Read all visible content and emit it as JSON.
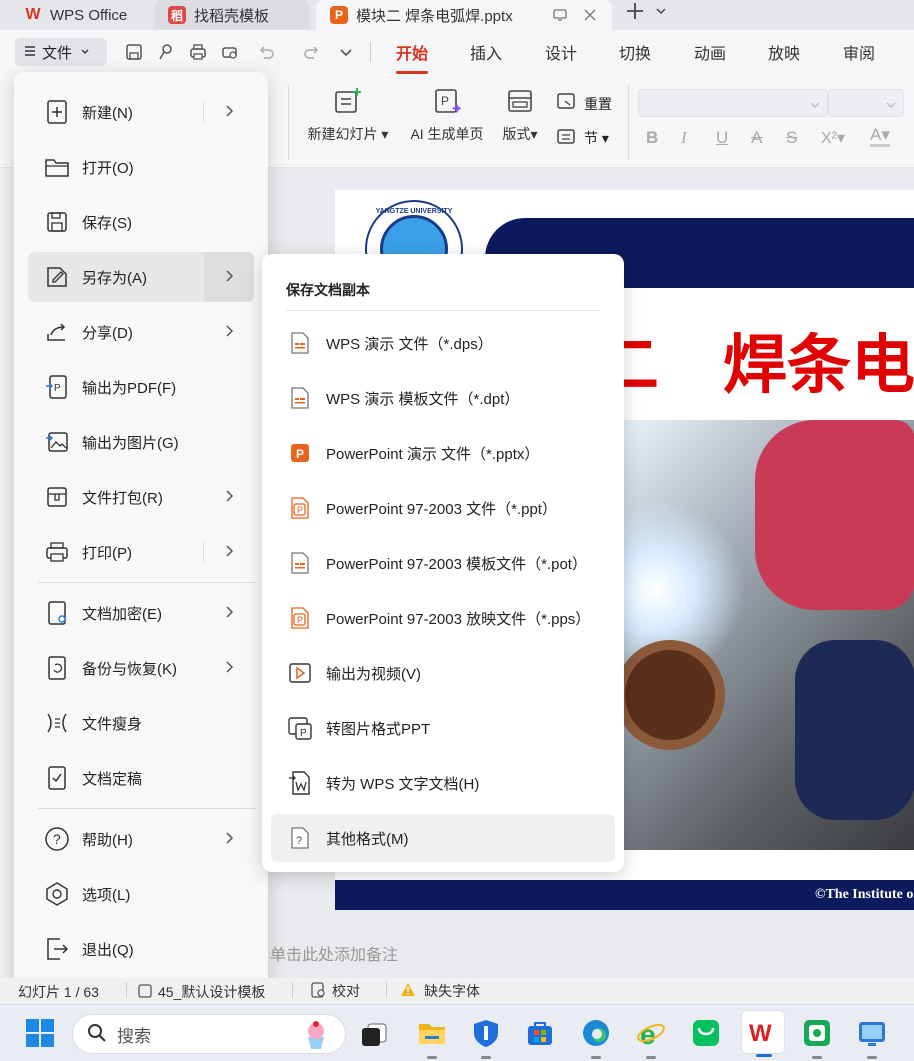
{
  "tabs": [
    {
      "label": "WPS Office"
    },
    {
      "label": "找稻壳模板"
    },
    {
      "label": "模块二 焊条电弧焊.pptx"
    }
  ],
  "toolbar": {
    "file_menu_label": "文件"
  },
  "ribbon_tabs": [
    "开始",
    "插入",
    "设计",
    "切换",
    "动画",
    "放映",
    "审阅"
  ],
  "ribbon": {
    "new_slide": "新建幻灯片",
    "ai_page": "AI 生成单页",
    "layout": "版式",
    "reset": "重置",
    "section": "节"
  },
  "file_menu": {
    "items": [
      {
        "label": "新建(N)",
        "icon": "new-file-icon"
      },
      {
        "label": "打开(O)",
        "icon": "folder-icon"
      },
      {
        "label": "保存(S)",
        "icon": "save-icon"
      },
      {
        "label": "另存为(A)",
        "icon": "save-as-icon"
      },
      {
        "label": "分享(D)",
        "icon": "share-icon"
      },
      {
        "label": "输出为PDF(F)",
        "icon": "pdf-icon"
      },
      {
        "label": "输出为图片(G)",
        "icon": "image-icon"
      },
      {
        "label": "文件打包(R)",
        "icon": "package-icon"
      },
      {
        "label": "打印(P)",
        "icon": "print-icon"
      },
      {
        "label": "文档加密(E)",
        "icon": "lock-icon"
      },
      {
        "label": "备份与恢复(K)",
        "icon": "backup-icon"
      },
      {
        "label": "文件瘦身",
        "icon": "slim-icon"
      },
      {
        "label": "文档定稿",
        "icon": "finalize-icon"
      },
      {
        "label": "帮助(H)",
        "icon": "help-icon"
      },
      {
        "label": "选项(L)",
        "icon": "options-icon"
      },
      {
        "label": "退出(Q)",
        "icon": "exit-icon"
      }
    ]
  },
  "save_as_menu": {
    "title": "保存文档副本",
    "items": [
      {
        "label": "WPS 演示 文件（*.dps）"
      },
      {
        "label": "WPS 演示 模板文件（*.dpt）"
      },
      {
        "label": "PowerPoint 演示 文件（*.pptx）"
      },
      {
        "label": "PowerPoint 97-2003 文件（*.ppt）"
      },
      {
        "label": "PowerPoint 97-2003 模板文件（*.pot）"
      },
      {
        "label": "PowerPoint 97-2003 放映文件（*.pps）"
      },
      {
        "label": "输出为视频(V)"
      },
      {
        "label": "转图片格式PPT"
      },
      {
        "label": "转为 WPS 文字文档(H)"
      },
      {
        "label": "其他格式(M)"
      }
    ]
  },
  "slide": {
    "logo_text": "YANGTZE UNIVERSITY",
    "title_fragment": "二　焊条电",
    "footer": "©The Institute o"
  },
  "notes_placeholder": "单击此处添加备注",
  "status": {
    "slide_counter": "幻灯片 1 / 63",
    "template": "45_默认设计模板",
    "proofread": "校对",
    "missing_font": "缺失字体"
  },
  "taskbar": {
    "search_placeholder": "搜索"
  },
  "colors": {
    "accent": "#d9341f",
    "slide_navy": "#0a1a5c",
    "title_red": "#e00000"
  }
}
